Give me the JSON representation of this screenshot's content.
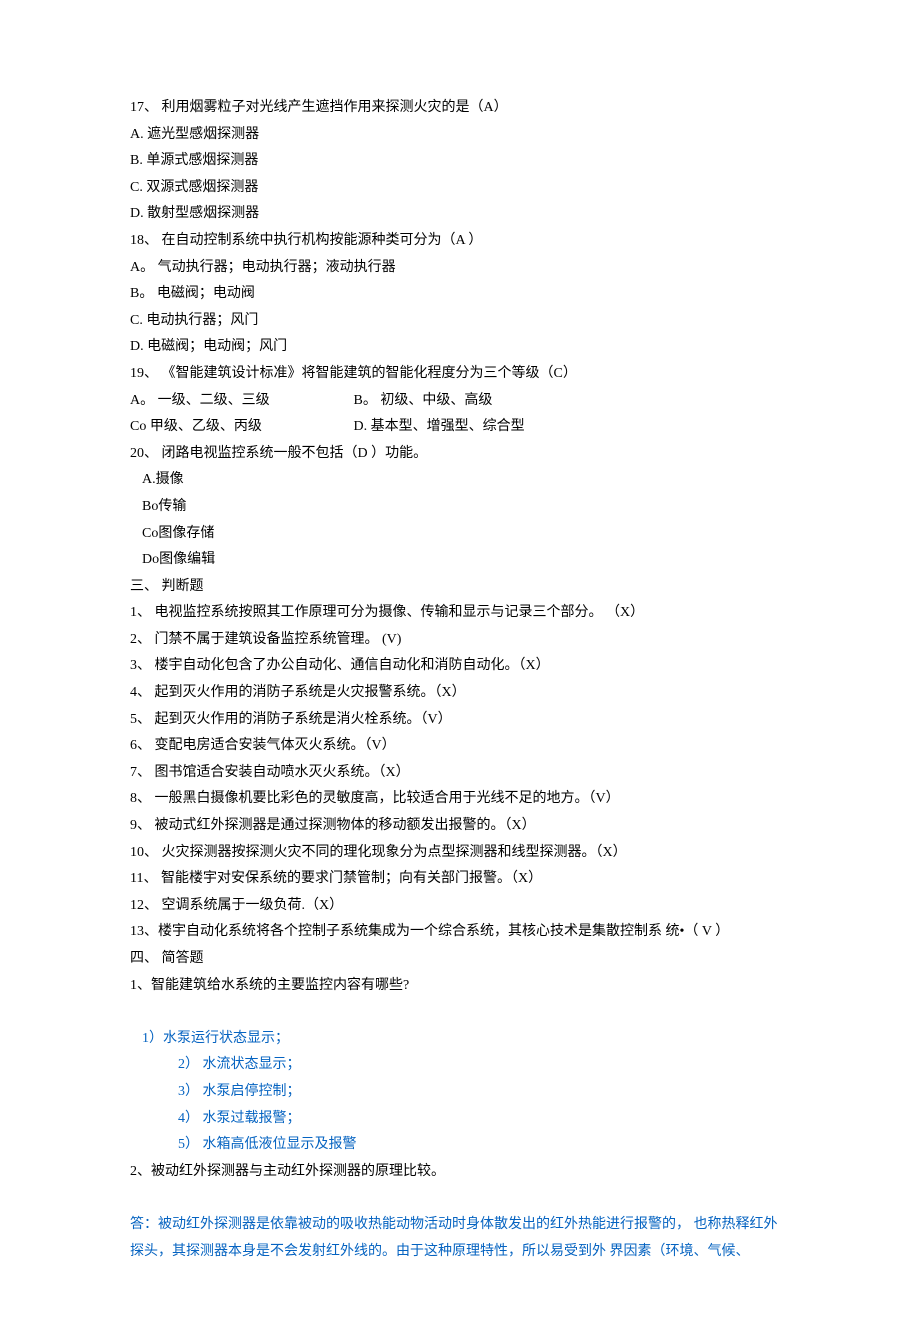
{
  "q17": {
    "stem": "17、 利用烟雾粒子对光线产生遮挡作用来探测火灾的是（A）",
    "a": "A.     遮光型感烟探测器",
    "b": "B.    单源式感烟探测器",
    "c": "C.    双源式感烟探测器",
    "d": "D.    散射型感烟探测器"
  },
  "q18": {
    "stem": "18、 在自动控制系统中执行机构按能源种类可分为（A ）",
    "a": "A。    气动执行器；电动执行器；液动执行器",
    "b": "B。    电磁阀；电动阀",
    "c": "C.    电动执行器；风门",
    "d": "D.    电磁阀；电动阀；风门"
  },
  "q19": {
    "stem": "19、 《智能建筑设计标准》将智能建筑的智能化程度分为三个等级（C）",
    "line1_a": "A。  一级、二级、三级",
    "line1_b": "B。    初级、中级、高级",
    "line2_a": "Co     甲级、乙级、丙级",
    "line2_b": "D. 基本型、增强型、综合型"
  },
  "q20": {
    "stem": "20、 闭路电视监控系统一般不包括（D ）功能。",
    "a": "A.摄像",
    "b": "Bo传输",
    "c": "Co图像存储",
    "d": "Do图像编辑"
  },
  "section3": "三、      判断题",
  "tf": {
    "i1": "1、   电视监控系统按照其工作原理可分为摄像、传输和显示与记录三个部分。               （X）",
    "i2": "2、   门禁不属于建筑设备监控系统管理。                      (V)",
    "i3": "3、   楼宇自动化包含了办公自动化、通信自动化和消防自动化。（X）",
    "i4": "4、   起到灭火作用的消防子系统是火灾报警系统。（X）",
    "i5": "5、   起到灭火作用的消防子系统是消火栓系统。（V）",
    "i6": "6、   变配电房适合安装气体灭火系统。（V）",
    "i7": "7、   图书馆适合安装自动喷水灭火系统。（X）",
    "i8": "8、   一般黑白摄像机要比彩色的灵敏度高，比较适合用于光线不足的地方。（V）",
    "i9": "9、   被动式红外探测器是通过探测物体的移动额发出报警的。（X）",
    "i10": "10、      火灾探测器按探测火灾不同的理化现象分为点型探测器和线型探测器。（X）",
    "i11": "11、      智能楼宇对安保系统的要求门禁管制；向有关部门报警。（X）",
    "i12": "12、      空调系统属于一级负荷.（X）",
    "i13": "13、楼宇自动化系统将各个控制子系统集成为一个综合系统，其核心技术是集散控制系 统•（ V ）"
  },
  "section4": "四、      简答题",
  "sa1": {
    "q": "1、智能建筑给水系统的主要监控内容有哪些?",
    "a1": "1）水泵运行状态显示；",
    "a2": "2） 水流状态显示；",
    "a3": "3）   水泵启停控制；",
    "a4": "4） 水泵过载报警；",
    "a5": "5）   水箱高低液位显示及报警"
  },
  "sa2": {
    "q": "2、被动红外探测器与主动红外探测器的原理比较。",
    "ans_p1": "答：被动红外探测器是依靠被动的吸收热能动物活动时身体散发出的红外热能进行报警的， 也称热释红外探头，其探测器本身是不会发射红外线的。由于这种原理特性，所以易受到外 界因素（环境、气候、"
  }
}
